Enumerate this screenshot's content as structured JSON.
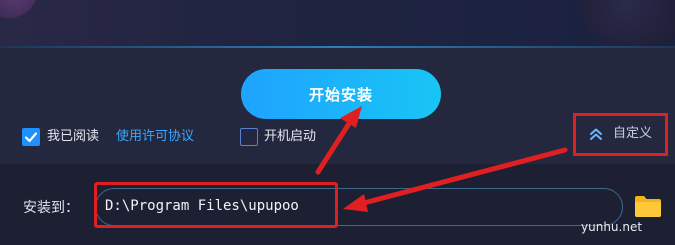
{
  "install_button": {
    "label": "开始安装"
  },
  "agreement": {
    "checkbox_checked": true,
    "label": "我已阅读",
    "link_label": "使用许可协议"
  },
  "autostart": {
    "checkbox_checked": false,
    "label": "开机启动"
  },
  "custom": {
    "label": "自定义",
    "icon": "double-chevron-up-icon"
  },
  "install_path": {
    "label": "安装到：",
    "value": "D:\\Program Files\\upupoo"
  },
  "folder_icon": "folder-icon",
  "watermark": "yunhu.net",
  "colors": {
    "accent": "#1fa3ff",
    "link": "#3aa6ff",
    "annotation": "#e02020",
    "background": "#1d2138"
  }
}
